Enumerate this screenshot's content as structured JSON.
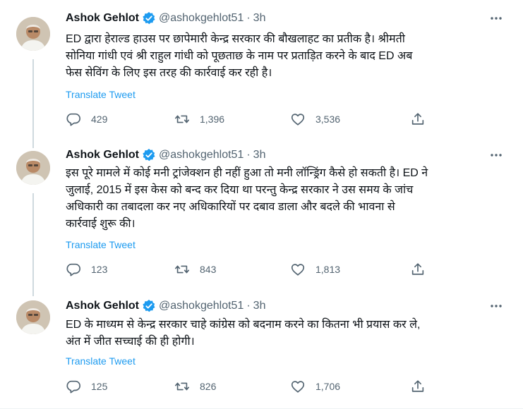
{
  "colors": {
    "accent": "#1d9bf0",
    "text_primary": "#0f1419",
    "text_secondary": "#536471",
    "thread_line": "#cfd9de",
    "divider": "#eff3f4"
  },
  "icons": {
    "verified": "verified-badge-icon",
    "more": "more-horizontal-icon",
    "reply": "reply-icon",
    "retweet": "retweet-icon",
    "like": "heart-icon",
    "share": "share-icon"
  },
  "tweets": [
    {
      "author_name": "Ashok Gehlot",
      "handle": "@ashokgehlot51",
      "separator": "·",
      "time": "3h",
      "lines": [
        "ED द्वारा हेराल्ड हाउस पर छापेमारी केन्द्र सरकार की बौखलाहट का प्रतीक है। श्रीमती",
        "सोनिया गांधी एवं श्री राहुल गांधी को पूछताछ के नाम पर प्रताड़ित करने के बाद ED अब",
        "फेस सेविंग के लिए इस तरह की कार्रवाई कर रही है।"
      ],
      "translate_label": "Translate Tweet",
      "replies": "429",
      "retweets": "1,396",
      "likes": "3,536"
    },
    {
      "author_name": "Ashok Gehlot",
      "handle": "@ashokgehlot51",
      "separator": "·",
      "time": "3h",
      "lines": [
        "इस पूरे मामले में कोई मनी ट्रांजेक्शन ही नहीं हुआ तो मनी लॉन्ड्रिंग कैसे हो सकती है। ED ने",
        "जुलाई, 2015 में इस केस को बन्द कर दिया था परन्तु केन्द्र सरकार ने उस समय के जांच",
        "अधिकारी का तबादला कर नए अधिकारियों पर दबाव डाला और बदले की भावना से",
        "कार्रवाई शुरू की।"
      ],
      "translate_label": "Translate Tweet",
      "replies": "123",
      "retweets": "843",
      "likes": "1,813"
    },
    {
      "author_name": "Ashok Gehlot",
      "handle": "@ashokgehlot51",
      "separator": "·",
      "time": "3h",
      "lines": [
        "ED के माध्यम से केन्द्र सरकार चाहे कांग्रेस को बदनाम करने का कितना भी प्रयास कर ले,",
        "अंत में जीत सच्चाई की ही होगी।"
      ],
      "translate_label": "Translate Tweet",
      "replies": "125",
      "retweets": "826",
      "likes": "1,706"
    }
  ]
}
